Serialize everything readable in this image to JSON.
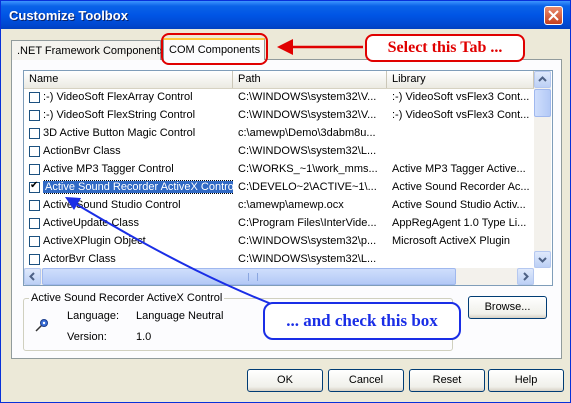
{
  "window": {
    "title": "Customize Toolbox"
  },
  "tabs": [
    {
      "label": ".NET Framework Components",
      "active": false
    },
    {
      "label": "COM Components",
      "active": true
    }
  ],
  "list": {
    "columns": [
      "Name",
      "Path",
      "Library"
    ],
    "rows": [
      {
        "name": ":-) VideoSoft FlexArray Control",
        "path": "C:\\WINDOWS\\system32\\V...",
        "library": ":-) VideoSoft vsFlex3 Cont...",
        "checked": false,
        "selected": false
      },
      {
        "name": ":-) VideoSoft FlexString Control",
        "path": "C:\\WINDOWS\\system32\\V...",
        "library": ":-) VideoSoft vsFlex3 Cont...",
        "checked": false,
        "selected": false
      },
      {
        "name": "3D Active Button Magic Control",
        "path": "c:\\amewp\\Demo\\3dabm8u...",
        "library": "",
        "checked": false,
        "selected": false
      },
      {
        "name": "ActionBvr Class",
        "path": "C:\\WINDOWS\\system32\\L...",
        "library": "",
        "checked": false,
        "selected": false
      },
      {
        "name": "Active MP3 Tagger Control",
        "path": "C:\\WORKS_~1\\work_mms...",
        "library": "Active MP3 Tagger Active...",
        "checked": false,
        "selected": false
      },
      {
        "name": "Active Sound Recorder ActiveX Control",
        "path": "C:\\DEVELO~2\\ACTIVE~1\\...",
        "library": "Active Sound Recorder Ac...",
        "checked": true,
        "selected": true
      },
      {
        "name": "Active Sound Studio Control",
        "path": "c:\\amewp\\amewp.ocx",
        "library": "Active Sound Studio Activ...",
        "checked": false,
        "selected": false
      },
      {
        "name": "ActiveUpdate Class",
        "path": "C:\\Program Files\\InterVide...",
        "library": "AppRegAgent 1.0 Type Li...",
        "checked": false,
        "selected": false
      },
      {
        "name": "ActiveXPlugin Object",
        "path": "C:\\WINDOWS\\system32\\p...",
        "library": "Microsoft ActiveX Plugin",
        "checked": false,
        "selected": false
      },
      {
        "name": "ActorBvr Class",
        "path": "C:\\WINDOWS\\system32\\L...",
        "library": "",
        "checked": false,
        "selected": false
      },
      {
        "name": "",
        "path": "",
        "library": "",
        "checked": false,
        "selected": false
      }
    ]
  },
  "details": {
    "group_title": "Active Sound Recorder ActiveX Control",
    "language_label": "Language:",
    "language_value": "Language Neutral",
    "version_label": "Version:",
    "version_value": "1.0"
  },
  "buttons": {
    "browse": "Browse...",
    "ok": "OK",
    "cancel": "Cancel",
    "reset": "Reset",
    "help": "Help"
  },
  "annotations": {
    "select_tab": "Select this Tab ...",
    "check_box": "... and check this box"
  },
  "colors": {
    "accent_red": "#e00000",
    "accent_blue": "#1a2ee6",
    "selection": "#316ac5"
  },
  "icons": {
    "component": "gear-pin-icon",
    "close": "close-icon"
  }
}
